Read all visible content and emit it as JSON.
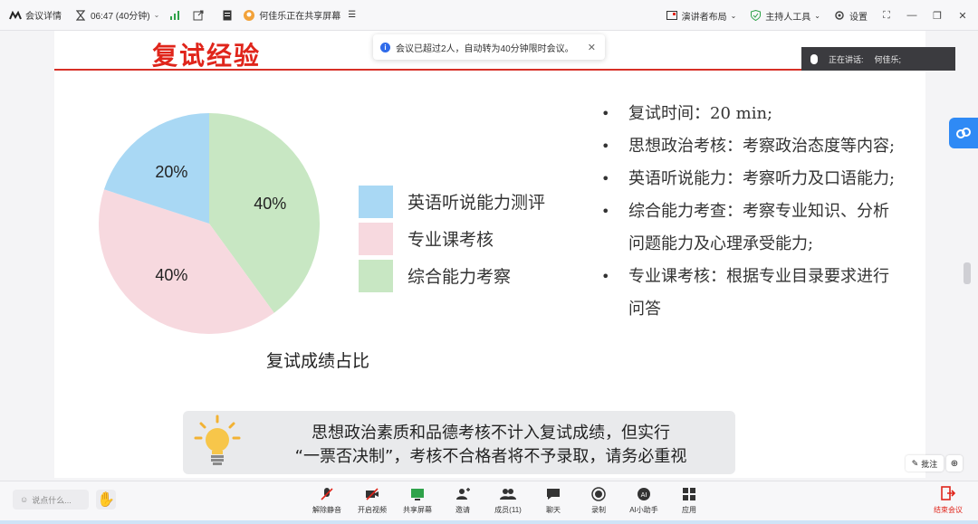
{
  "topbar": {
    "meeting_details": "会议详情",
    "timer": "06:47 (40分钟)",
    "sharing": "何佳乐正在共享屏幕",
    "layout": "演讲者布局",
    "ai_host": "主持人工具",
    "settings": "设置"
  },
  "notice": {
    "text": "会议已超过2人，自动转为40分钟限时会议。"
  },
  "speaking": {
    "label": "正在讲话:",
    "name": "何佳乐;"
  },
  "slide": {
    "title": "复试经验",
    "pie": {
      "caption": "复试成绩占比",
      "legend": [
        "英语听说能力测评",
        "专业课考核",
        "综合能力考察"
      ]
    },
    "bullets": [
      {
        "bullet": "•",
        "text": "复试时间：20 min;"
      },
      {
        "bullet": "•",
        "text": "思想政治考核：考察政治态度等内容;"
      },
      {
        "bullet": "•",
        "text": "英语听说能力：考察听力及口语能力;"
      },
      {
        "bullet": "•",
        "text": "综合能力考查：考察专业知识、分析问题能力及心理承受能力;"
      },
      {
        "bullet": "•",
        "text": "专业课考核：根据专业目录要求进行问答"
      }
    ],
    "banner": {
      "line1": "思想政治素质和品德考核不计入复试成绩，但实行",
      "line2": "“一票否决制”，考核不合格者将不予录取，请务必重视"
    }
  },
  "chart_data": {
    "type": "pie",
    "categories": [
      "英语听说能力测评",
      "专业课考核",
      "综合能力考察"
    ],
    "values": [
      20,
      40,
      40
    ],
    "labels": [
      "20%",
      "40%",
      "40%"
    ],
    "colors": [
      "#a9d8f4",
      "#f7d9df",
      "#c8e7c3"
    ],
    "title": "复试成绩占比"
  },
  "annotate": {
    "label": "批注"
  },
  "bottombar": {
    "say_placeholder": "说点什么...",
    "tools": [
      {
        "label": "解除静音",
        "icon": "mic-off-icon"
      },
      {
        "label": "开启视频",
        "icon": "camera-off-icon"
      },
      {
        "label": "共享屏幕",
        "icon": "share-screen-icon"
      },
      {
        "label": "邀请",
        "icon": "invite-icon"
      },
      {
        "label": "成员(11)",
        "icon": "members-icon"
      },
      {
        "label": "聊天",
        "icon": "chat-icon"
      },
      {
        "label": "录制",
        "icon": "record-icon"
      },
      {
        "label": "AI小助手",
        "icon": "ai-assistant-icon"
      },
      {
        "label": "应用",
        "icon": "apps-icon"
      }
    ],
    "end_label": "结束会议"
  }
}
